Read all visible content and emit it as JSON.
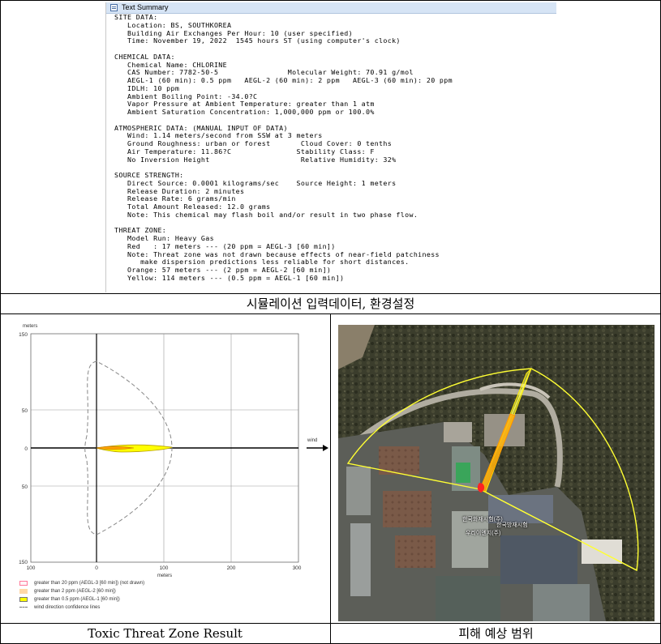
{
  "text_summary": {
    "window_title": "Text Summary",
    "lines": [
      "SITE DATA:",
      "   Location: BS, SOUTHKOREA",
      "   Building Air Exchanges Per Hour: 10 (user specified)",
      "   Time: November 19, 2022  1545 hours ST (using computer's clock)",
      "",
      "CHEMICAL DATA:",
      "   Chemical Name: CHLORINE",
      "   CAS Number: 7782-50-5                Molecular Weight: 70.91 g/mol",
      "   AEGL-1 (60 min): 0.5 ppm   AEGL-2 (60 min): 2 ppm   AEGL-3 (60 min): 20 ppm",
      "   IDLH: 10 ppm",
      "   Ambient Boiling Point: -34.0?C",
      "   Vapor Pressure at Ambient Temperature: greater than 1 atm",
      "   Ambient Saturation Concentration: 1,000,000 ppm or 100.0%",
      "",
      "ATMOSPHERIC DATA: (MANUAL INPUT OF DATA)",
      "   Wind: 1.14 meters/second from SSW at 3 meters",
      "   Ground Roughness: urban or forest       Cloud Cover: 0 tenths",
      "   Air Temperature: 11.86?C               Stability Class: F",
      "   No Inversion Height                     Relative Humidity: 32%",
      "",
      "SOURCE STRENGTH:",
      "   Direct Source: 0.0001 kilograms/sec    Source Height: 1 meters",
      "   Release Duration: 2 minutes",
      "   Release Rate: 6 grams/min",
      "   Total Amount Released: 12.0 grams",
      "   Note: This chemical may flash boil and/or result in two phase flow.",
      "",
      "THREAT ZONE:",
      "   Model Run: Heavy Gas",
      "   Red   : 17 meters --- (20 ppm = AEGL-3 [60 min])",
      "   Note: Threat zone was not drawn because effects of near-field patchiness",
      "      make dispersion predictions less reliable for short distances.",
      "   Orange: 57 meters --- (2 ppm = AEGL-2 [60 min])",
      "   Yellow: 114 meters --- (0.5 ppm = AEGL-1 [60 min])"
    ]
  },
  "captions": {
    "top": "시뮬레이션 입력데이터, 환경설정",
    "left": "Toxic Threat Zone Result",
    "right": "피해 예상 범위"
  },
  "plot": {
    "axis_units_top": "meters",
    "axis_units_bottom": "meters",
    "y_ticks": [
      "150",
      "50",
      "0",
      "50",
      "150"
    ],
    "x_ticks": [
      "100",
      "0",
      "100",
      "200",
      "300"
    ],
    "wind_label": "wind"
  },
  "legend": [
    {
      "text": "greater than 20 ppm (AEGL-3 [60 min]) (not drawn)",
      "color": "#ffb6c1"
    },
    {
      "text": "greater than 2 ppm (AEGL-2 [60 min])",
      "color": "#ffd8a8"
    },
    {
      "text": "greater than 0.5 ppm (AEGL-1 [60 min])",
      "color": "#ffff00"
    },
    {
      "text": "wind direction confidence lines",
      "color": "#888888"
    }
  ],
  "map_labels": [
    "한국화재시험(주)",
    "한국방재시험",
    "우리이엔지(주)"
  ],
  "colors": {
    "yellow_zone": "#ffff00",
    "orange_zone": "#ffa500",
    "confidence": "#888888"
  }
}
